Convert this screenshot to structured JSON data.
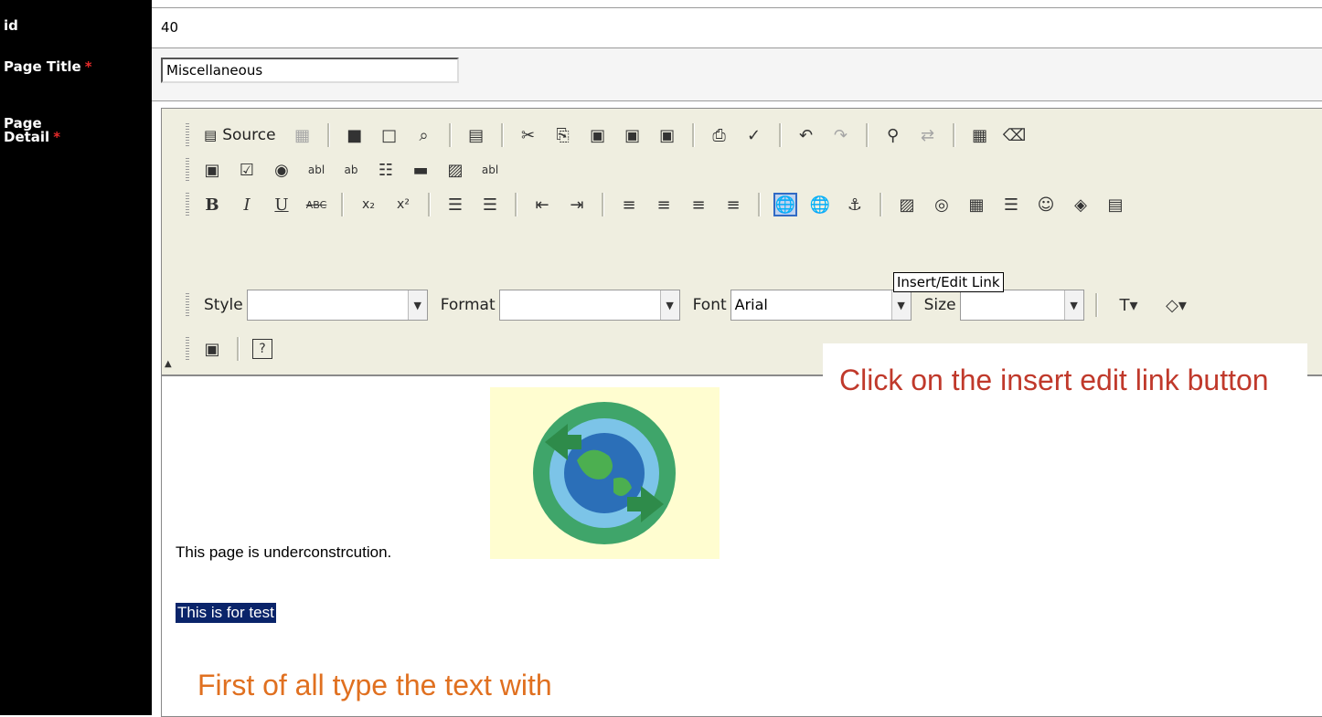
{
  "form": {
    "id_label": "id",
    "id_value": "40",
    "title_label": "Page Title",
    "title_value": "Miscellaneous",
    "detail_label_line1": "Page",
    "detail_label_line2": "Detail",
    "required_mark": "*"
  },
  "toolbar": {
    "source_label": "Source",
    "style_label": "Style",
    "style_value": "",
    "format_label": "Format",
    "format_value": "",
    "font_label": "Font",
    "font_value": "Arial",
    "size_label": "Size",
    "size_value": "",
    "tooltip": "Insert/Edit Link"
  },
  "content": {
    "paragraph1": "This page is underconstrcution.",
    "paragraph2_selected": "This is for test"
  },
  "annotations": {
    "red": "Click on the insert edit link button",
    "orange": "First of all type the text with"
  },
  "colors": {
    "label_bg": "#000000",
    "toolbar_bg": "#efeee0",
    "selection_bg": "#0a246a",
    "annotation_red": "#c0392b",
    "annotation_orange": "#e07020"
  }
}
